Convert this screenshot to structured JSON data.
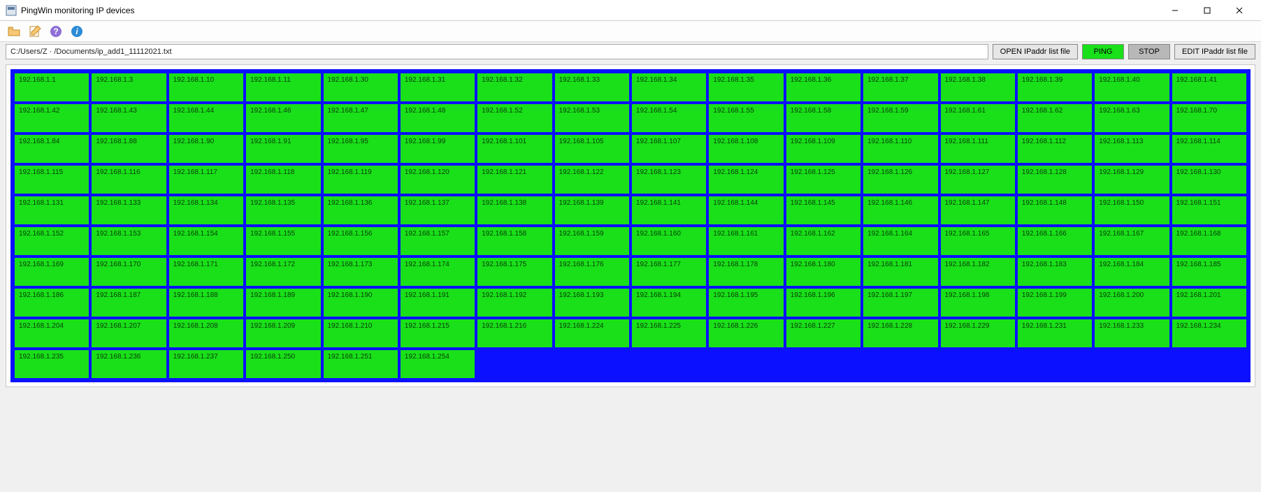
{
  "window": {
    "title": "PingWin monitoring IP devices"
  },
  "toolbar": {
    "open_tt": "Open",
    "edit_tt": "Edit",
    "help_tt": "Help",
    "info_tt": "Info"
  },
  "cmd": {
    "path_value": "C:/Users/Z · /Documents/ip_add1_11112021.txt",
    "open_label": "OPEN IPaddr list file",
    "ping_label": "PING",
    "stop_label": "STOP",
    "edit_label": "EDIT IPaddr list file"
  },
  "grid": {
    "cells": [
      "192.168.1.1",
      "192.168.1.3",
      "192.168.1.10",
      "192.168.1.11",
      "192.168.1.30",
      "192.168.1.31",
      "192.168.1.32",
      "192.168.1.33",
      "192.168.1.34",
      "192.168.1.35",
      "192.168.1.36",
      "192.168.1.37",
      "192.168.1.38",
      "192.168.1.39",
      "192.168.1.40",
      "192.168.1.41",
      "192.168.1.42",
      "192.168.1.43",
      "192.168.1.44",
      "192.168.1.46",
      "192.168.1.47",
      "192.168.1.48",
      "192.168.1.52",
      "192.168.1.53",
      "192.168.1.54",
      "192.168.1.55",
      "192.168.1.58",
      "192.168.1.59",
      "192.168.1.61",
      "192.168.1.62",
      "192.168.1.63",
      "192.168.1.70",
      "192.168.1.84",
      "192.168.1.88",
      "192.168.1.90",
      "192.168.1.91",
      "192.168.1.95",
      "192.168.1.99",
      "192.168.1.101",
      "192.168.1.105",
      "192.168.1.107",
      "192.168.1.108",
      "192.168.1.109",
      "192.168.1.110",
      "192.168.1.111",
      "192.168.1.112",
      "192.168.1.113",
      "192.168.1.114",
      "192.168.1.115",
      "192.168.1.116",
      "192.168.1.117",
      "192.168.1.118",
      "192.168.1.119",
      "192.168.1.120",
      "192.168.1.121",
      "192.168.1.122",
      "192.168.1.123",
      "192.168.1.124",
      "192.168.1.125",
      "192.168.1.126",
      "192.168.1.127",
      "192.168.1.128",
      "192.168.1.129",
      "192.168.1.130",
      "192.168.1.131",
      "192.168.1.133",
      "192.168.1.134",
      "192.168.1.135",
      "192.168.1.136",
      "192.168.1.137",
      "192.168.1.138",
      "192.168.1.139",
      "192.168.1.141",
      "192.168.1.144",
      "192.168.1.145",
      "192.168.1.146",
      "192.168.1.147",
      "192.168.1.148",
      "192.168.1.150",
      "192.168.1.151",
      "192.168.1.152",
      "192.168.1.153",
      "192.168.1.154",
      "192.168.1.155",
      "192.168.1.156",
      "192.168.1.157",
      "192.168.1.158",
      "192.168.1.159",
      "192.168.1.160",
      "192.168.1.161",
      "192.168.1.162",
      "192.168.1.164",
      "192.168.1.165",
      "192.168.1.166",
      "192.168.1.167",
      "192.168.1.168",
      "192.168.1.169",
      "192.168.1.170",
      "192.168.1.171",
      "192.168.1.172",
      "192.168.1.173",
      "192.168.1.174",
      "192.168.1.175",
      "192.168.1.176",
      "192.168.1.177",
      "192.168.1.178",
      "192.168.1.180",
      "192.168.1.181",
      "192.168.1.182",
      "192.168.1.183",
      "192.168.1.184",
      "192.168.1.185",
      "192.168.1.186",
      "192.168.1.187",
      "192.168.1.188",
      "192.168.1.189",
      "192.168.1.190",
      "192.168.1.191",
      "192.168.1.192",
      "192.168.1.193",
      "192.168.1.194",
      "192.168.1.195",
      "192.168.1.196",
      "192.168.1.197",
      "192.168.1.198",
      "192.168.1.199",
      "192.168.1.200",
      "192.168.1.201",
      "192.168.1.204",
      "192.168.1.207",
      "192.168.1.208",
      "192.168.1.209",
      "192.168.1.210",
      "192.168.1.215",
      "192.168.1.216",
      "192.168.1.224",
      "192.168.1.225",
      "192.168.1.226",
      "192.168.1.227",
      "192.168.1.228",
      "192.168.1.229",
      "192.168.1.231",
      "192.168.1.233",
      "192.168.1.234",
      "192.168.1.235",
      "192.168.1.236",
      "192.168.1.237",
      "192.168.1.250",
      "192.168.1.251",
      "192.168.1.254"
    ],
    "status_color_ok": "#19e019",
    "border_color": "#0b10ff"
  }
}
